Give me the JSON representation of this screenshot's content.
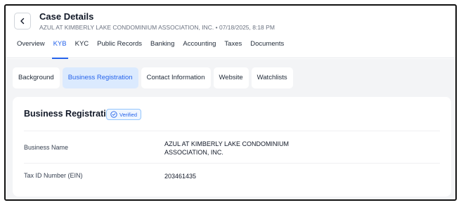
{
  "header": {
    "title": "Case Details",
    "subtitle": "AZUL AT KIMBERLY LAKE CONDOMINIUM ASSOCIATION, INC. • 07/18/2025, 8:18 PM"
  },
  "main_tabs": [
    {
      "label": "Overview",
      "active": false
    },
    {
      "label": "KYB",
      "active": true
    },
    {
      "label": "KYC",
      "active": false
    },
    {
      "label": "Public Records",
      "active": false
    },
    {
      "label": "Banking",
      "active": false
    },
    {
      "label": "Accounting",
      "active": false
    },
    {
      "label": "Taxes",
      "active": false
    },
    {
      "label": "Documents",
      "active": false
    }
  ],
  "sub_tabs": [
    {
      "label": "Background",
      "active": false
    },
    {
      "label": "Business Registration",
      "active": true
    },
    {
      "label": "Contact Information",
      "active": false
    },
    {
      "label": "Website",
      "active": false
    },
    {
      "label": "Watchlists",
      "active": false
    }
  ],
  "card": {
    "title": "Business Registration",
    "badge": "Verified",
    "rows": [
      {
        "label": "Business Name",
        "value": "AZUL AT KIMBERLY LAKE CONDOMINIUM ASSOCIATION, INC."
      },
      {
        "label": "Tax ID Number (EIN)",
        "value": "203461435"
      }
    ]
  },
  "colors": {
    "accent": "#2563eb",
    "active_subtab_bg": "#dbeafe",
    "content_bg": "#f3f4f6"
  },
  "icons": {
    "back": "chevron-left-icon",
    "verified": "check-circle-icon"
  }
}
